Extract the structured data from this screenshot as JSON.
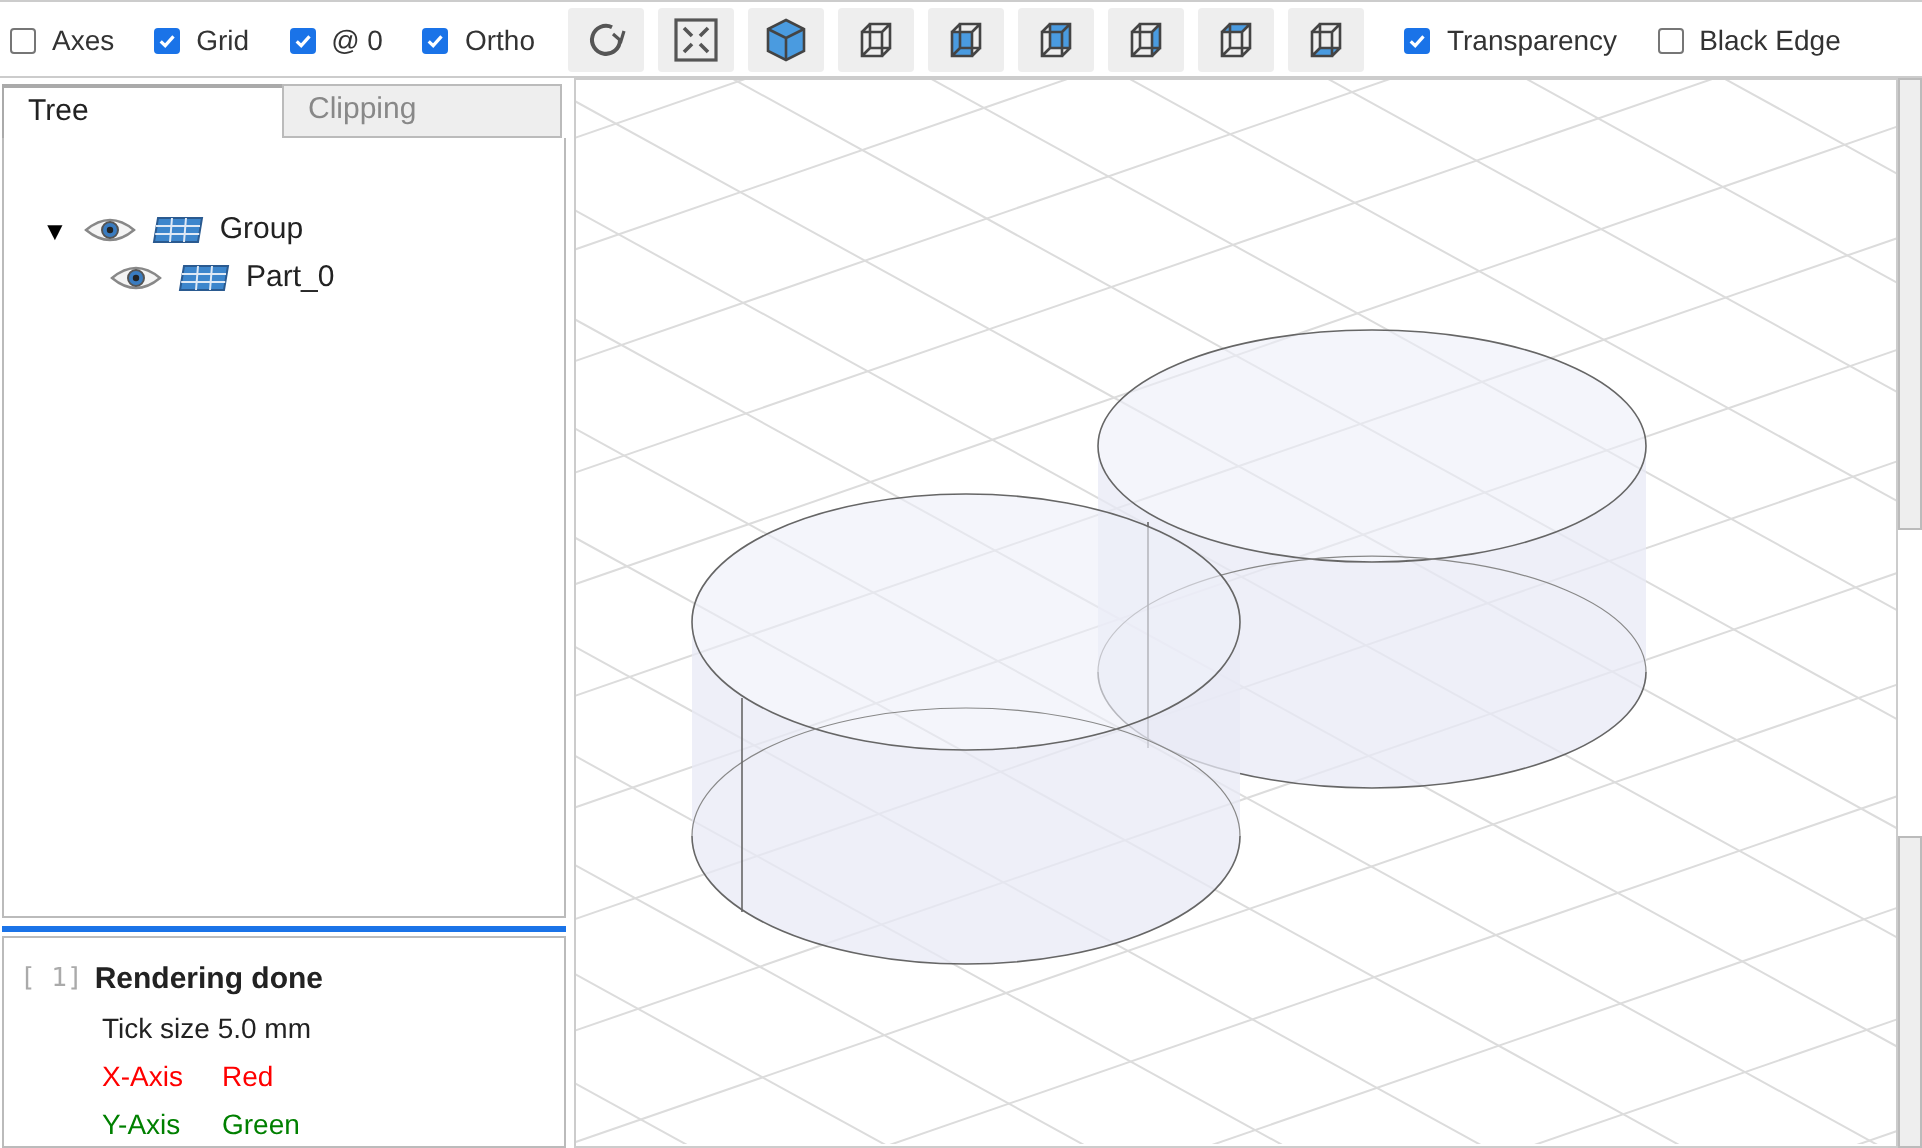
{
  "toolbar": {
    "left_options": [
      {
        "label": "Axes",
        "checked": false
      },
      {
        "label": "Grid",
        "checked": true
      },
      {
        "label": "@ 0",
        "checked": true
      },
      {
        "label": "Ortho",
        "checked": true
      }
    ],
    "right_options": [
      {
        "label": "Transparency",
        "checked": true
      },
      {
        "label": "Black Edge",
        "checked": false
      }
    ]
  },
  "tabs": [
    {
      "label": "Tree",
      "selected": true
    },
    {
      "label": "Clipping",
      "selected": false
    }
  ],
  "tree": [
    {
      "label": "Group",
      "expanded": true,
      "toggle": "▼",
      "children": [
        {
          "label": "Part_0"
        }
      ]
    }
  ],
  "log": {
    "index": "[ 1]",
    "title": "Rendering done",
    "message": "Tick size 5.0 mm",
    "axes": [
      {
        "label": "X-Axis",
        "value": "Red",
        "color": "#ff0000"
      },
      {
        "label": "Y-Axis",
        "value": "Green",
        "color": "#008000"
      }
    ]
  }
}
